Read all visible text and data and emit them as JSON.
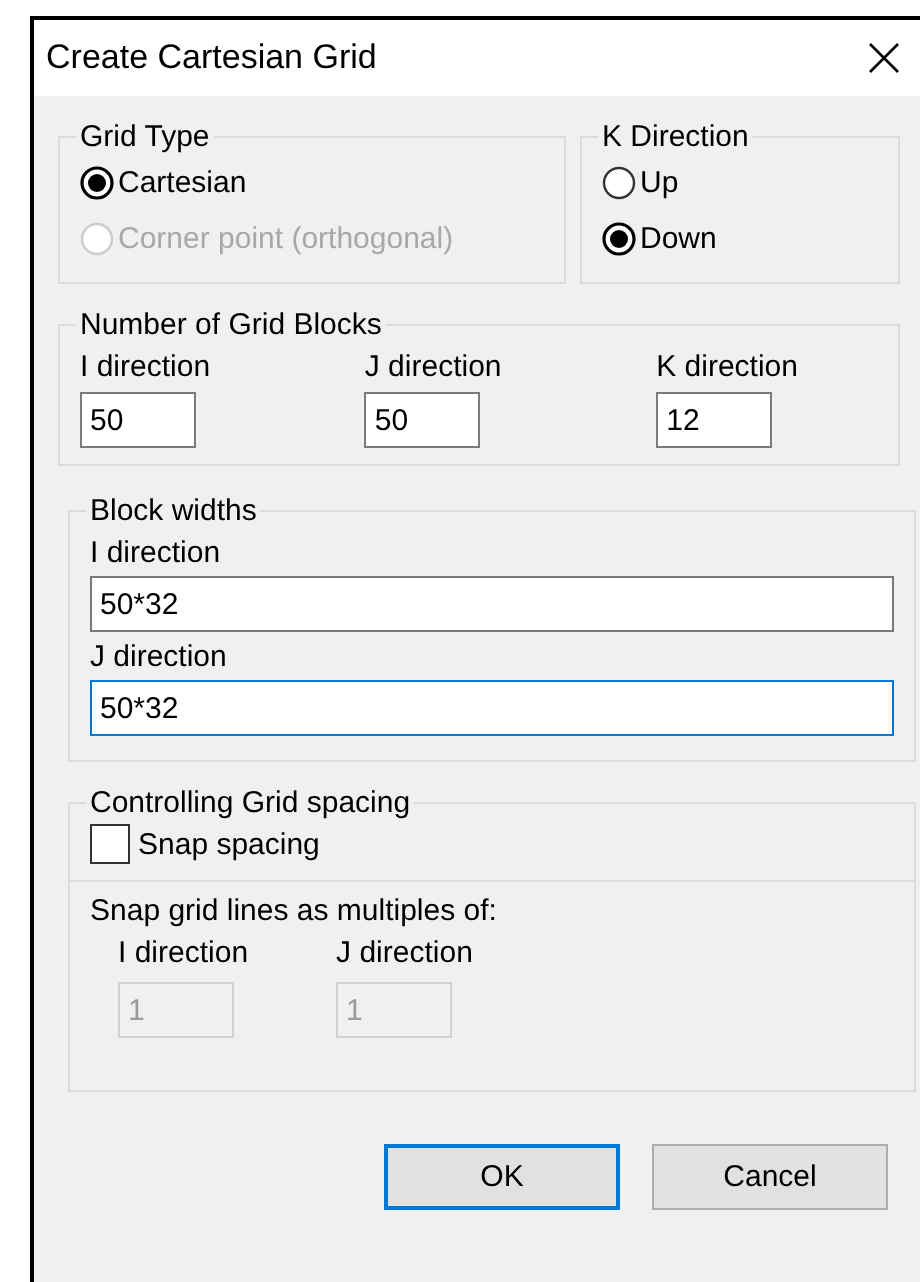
{
  "window": {
    "title": "Create Cartesian Grid"
  },
  "grid_type": {
    "label": "Grid Type",
    "options": [
      {
        "label": "Cartesian",
        "selected": true,
        "disabled": false
      },
      {
        "label": "Corner point (orthogonal)",
        "selected": false,
        "disabled": true
      }
    ]
  },
  "k_direction": {
    "label": "K Direction",
    "options": [
      {
        "label": "Up",
        "selected": false,
        "disabled": false
      },
      {
        "label": "Down",
        "selected": true,
        "disabled": false
      }
    ]
  },
  "grid_blocks": {
    "label": "Number of Grid Blocks",
    "fields": [
      {
        "label": "I direction",
        "value": "50"
      },
      {
        "label": "J direction",
        "value": "50"
      },
      {
        "label": "K direction",
        "value": "12"
      }
    ]
  },
  "block_widths": {
    "label": "Block widths",
    "fields": [
      {
        "label": "I direction",
        "value": "50*32",
        "focused": false
      },
      {
        "label": "J direction",
        "value": "50*32",
        "focused": true
      }
    ]
  },
  "grid_spacing": {
    "label": "Controlling Grid spacing",
    "snap": {
      "label": "Snap spacing",
      "checked": false
    },
    "multiples": {
      "label": "Snap grid lines as multiples of:",
      "fields": [
        {
          "label": "I direction",
          "value": "1",
          "disabled": true
        },
        {
          "label": "J direction",
          "value": "1",
          "disabled": true
        }
      ]
    }
  },
  "buttons": [
    {
      "label": "OK",
      "default": true
    },
    {
      "label": "Cancel",
      "default": false
    }
  ]
}
